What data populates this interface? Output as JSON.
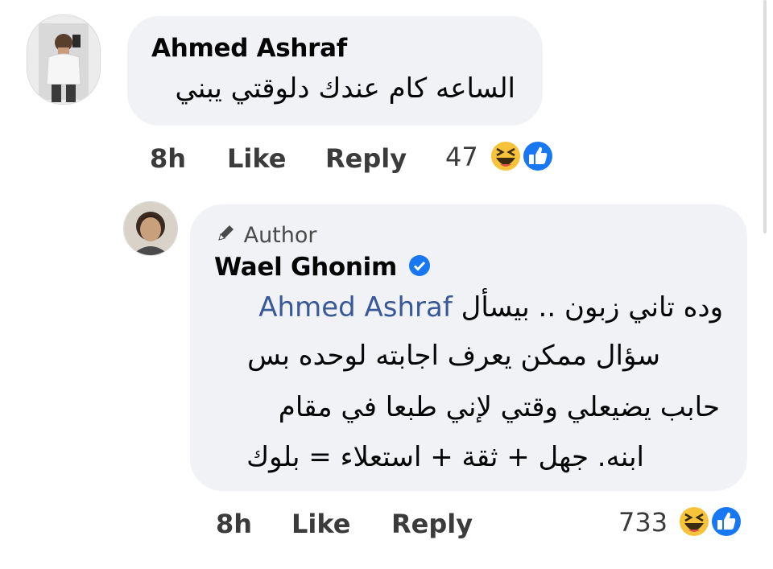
{
  "comment1": {
    "author": "Ahmed Ashraf",
    "text": "الساعه كام عندك دلوقتي يبني",
    "time": "8h",
    "like_label": "Like",
    "reply_label": "Reply",
    "reaction_count": "47",
    "reactions": [
      "haha-icon",
      "like-icon"
    ]
  },
  "reply1": {
    "badge_icon": "pencil-icon",
    "badge_label": "Author",
    "author": "Wael Ghonim",
    "verified_icon": "verified-badge-icon",
    "mention": "Ahmed Ashraf",
    "line1_prefix": "وده تاني زبون .. بيسأل",
    "line2": "سؤال ممكن يعرف اجابته لوحده بس",
    "line3": "حابب يضيعلي وقتي لإني طبعا في مقام",
    "line4": "ابنه. جهل + ثقة + استعلاء = بلوك",
    "time": "8h",
    "like_label": "Like",
    "reply_label": "Reply",
    "reaction_count": "733",
    "reactions": [
      "haha-icon",
      "like-icon"
    ]
  },
  "colors": {
    "bubble": "#f0f2f5",
    "mention": "#385898",
    "verified": "#1877f2",
    "like_blue": "#1877f2",
    "haha_yellow": "#f7c33a"
  }
}
